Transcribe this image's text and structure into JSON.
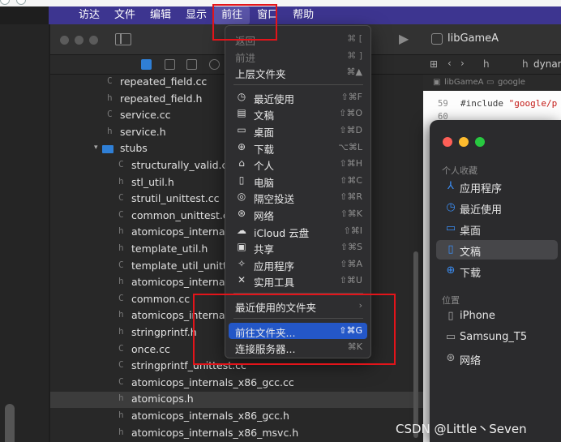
{
  "menubar": {
    "items": [
      "访达",
      "文件",
      "编辑",
      "显示",
      "前往",
      "窗口",
      "帮助"
    ],
    "active_index": 4
  },
  "xcode": {
    "scheme": "libGameA",
    "files": [
      {
        "icon": "C",
        "name": "repeated_field.cc",
        "indent": 1
      },
      {
        "icon": "h",
        "name": "repeated_field.h",
        "indent": 1
      },
      {
        "icon": "C",
        "name": "service.cc",
        "indent": 1
      },
      {
        "icon": "h",
        "name": "service.h",
        "indent": 1
      },
      {
        "icon": "folder",
        "name": "stubs",
        "indent": 1
      },
      {
        "icon": "C",
        "name": "structurally_valid.cc",
        "indent": 2
      },
      {
        "icon": "h",
        "name": "stl_util.h",
        "indent": 2
      },
      {
        "icon": "C",
        "name": "strutil_unittest.cc",
        "indent": 2
      },
      {
        "icon": "C",
        "name": "common_unittest.cc",
        "indent": 2
      },
      {
        "icon": "h",
        "name": "atomicops_internals_",
        "indent": 2
      },
      {
        "icon": "h",
        "name": "template_util.h",
        "indent": 2
      },
      {
        "icon": "C",
        "name": "template_util_unittes",
        "indent": 2
      },
      {
        "icon": "h",
        "name": "atomicops_internals_",
        "indent": 2
      },
      {
        "icon": "C",
        "name": "common.cc",
        "indent": 2
      },
      {
        "icon": "h",
        "name": "atomicops_internals_",
        "indent": 2
      },
      {
        "icon": "h",
        "name": "stringprintf.h",
        "indent": 2
      },
      {
        "icon": "C",
        "name": "once.cc",
        "indent": 2
      },
      {
        "icon": "C",
        "name": "stringprintf_unittest.cc",
        "indent": 2
      },
      {
        "icon": "C",
        "name": "atomicops_internals_x86_gcc.cc",
        "indent": 2
      },
      {
        "icon": "h",
        "name": "atomicops.h",
        "indent": 2,
        "selected": true
      },
      {
        "icon": "h",
        "name": "atomicops_internals_x86_gcc.h",
        "indent": 2
      },
      {
        "icon": "h",
        "name": "atomicops_internals_x86_msvc.h",
        "indent": 2
      }
    ],
    "editor": {
      "tab_h": "h",
      "tab_name": "dynam",
      "jump_root": "libGameA",
      "jump_folder": "google",
      "lines": [
        {
          "num": "59",
          "text_pre": "#include ",
          "text_str": "\"google/p"
        },
        {
          "num": "60",
          "text_pre": "",
          "text_str": ""
        }
      ]
    }
  },
  "finder": {
    "favorites_header": "个人收藏",
    "favorites": [
      {
        "icon": "apps-icon",
        "label": "应用程序"
      },
      {
        "icon": "recent-icon",
        "label": "最近使用"
      },
      {
        "icon": "desktop-icon",
        "label": "桌面"
      },
      {
        "icon": "document-icon",
        "label": "文稿",
        "selected": true
      },
      {
        "icon": "downloads-icon",
        "label": "下载"
      }
    ],
    "locations_header": "位置",
    "locations": [
      {
        "icon": "iphone-icon",
        "label": "iPhone"
      },
      {
        "icon": "drive-icon",
        "label": "Samsung_T5"
      },
      {
        "icon": "network-icon",
        "label": "网络"
      }
    ]
  },
  "go_menu": {
    "items": [
      {
        "label": "返回",
        "shortcut": "⌘ [",
        "disabled": true
      },
      {
        "label": "前进",
        "shortcut": "⌘ ]",
        "disabled": true
      },
      {
        "label": "上层文件夹",
        "shortcut": "⌘▲"
      },
      {
        "sep": true
      },
      {
        "label": "最近使用",
        "shortcut": "⇧⌘F",
        "icon": "◷"
      },
      {
        "label": "文稿",
        "shortcut": "⇧⌘O",
        "icon": "▤"
      },
      {
        "label": "桌面",
        "shortcut": "⇧⌘D",
        "icon": "▭"
      },
      {
        "label": "下载",
        "shortcut": "⌥⌘L",
        "icon": "⊕"
      },
      {
        "label": "个人",
        "shortcut": "⇧⌘H",
        "icon": "⌂"
      },
      {
        "label": "电脑",
        "shortcut": "⇧⌘C",
        "icon": "▯"
      },
      {
        "label": "隔空投送",
        "shortcut": "⇧⌘R",
        "icon": "◎"
      },
      {
        "label": "网络",
        "shortcut": "⇧⌘K",
        "icon": "⊛"
      },
      {
        "label": "iCloud 云盘",
        "shortcut": "⇧⌘I",
        "icon": "☁"
      },
      {
        "label": "共享",
        "shortcut": "⇧⌘S",
        "icon": "▣"
      },
      {
        "label": "应用程序",
        "shortcut": "⇧⌘A",
        "icon": "✧"
      },
      {
        "label": "实用工具",
        "shortcut": "⇧⌘U",
        "icon": "✕"
      },
      {
        "sep": true
      },
      {
        "label": "最近使用的文件夹",
        "shortcut": "›"
      },
      {
        "sep": true
      },
      {
        "label": "前往文件夹...",
        "shortcut": "⇧⌘G",
        "highlighted": true
      },
      {
        "label": "连接服务器...",
        "shortcut": "⌘K"
      }
    ]
  },
  "watermark": "CSDN @Little丶Seven",
  "colors": {
    "menubar": "#3d3590",
    "highlight": "#2457c7",
    "annotation": "#e3141a",
    "finder_accent": "#3b8ef5"
  }
}
